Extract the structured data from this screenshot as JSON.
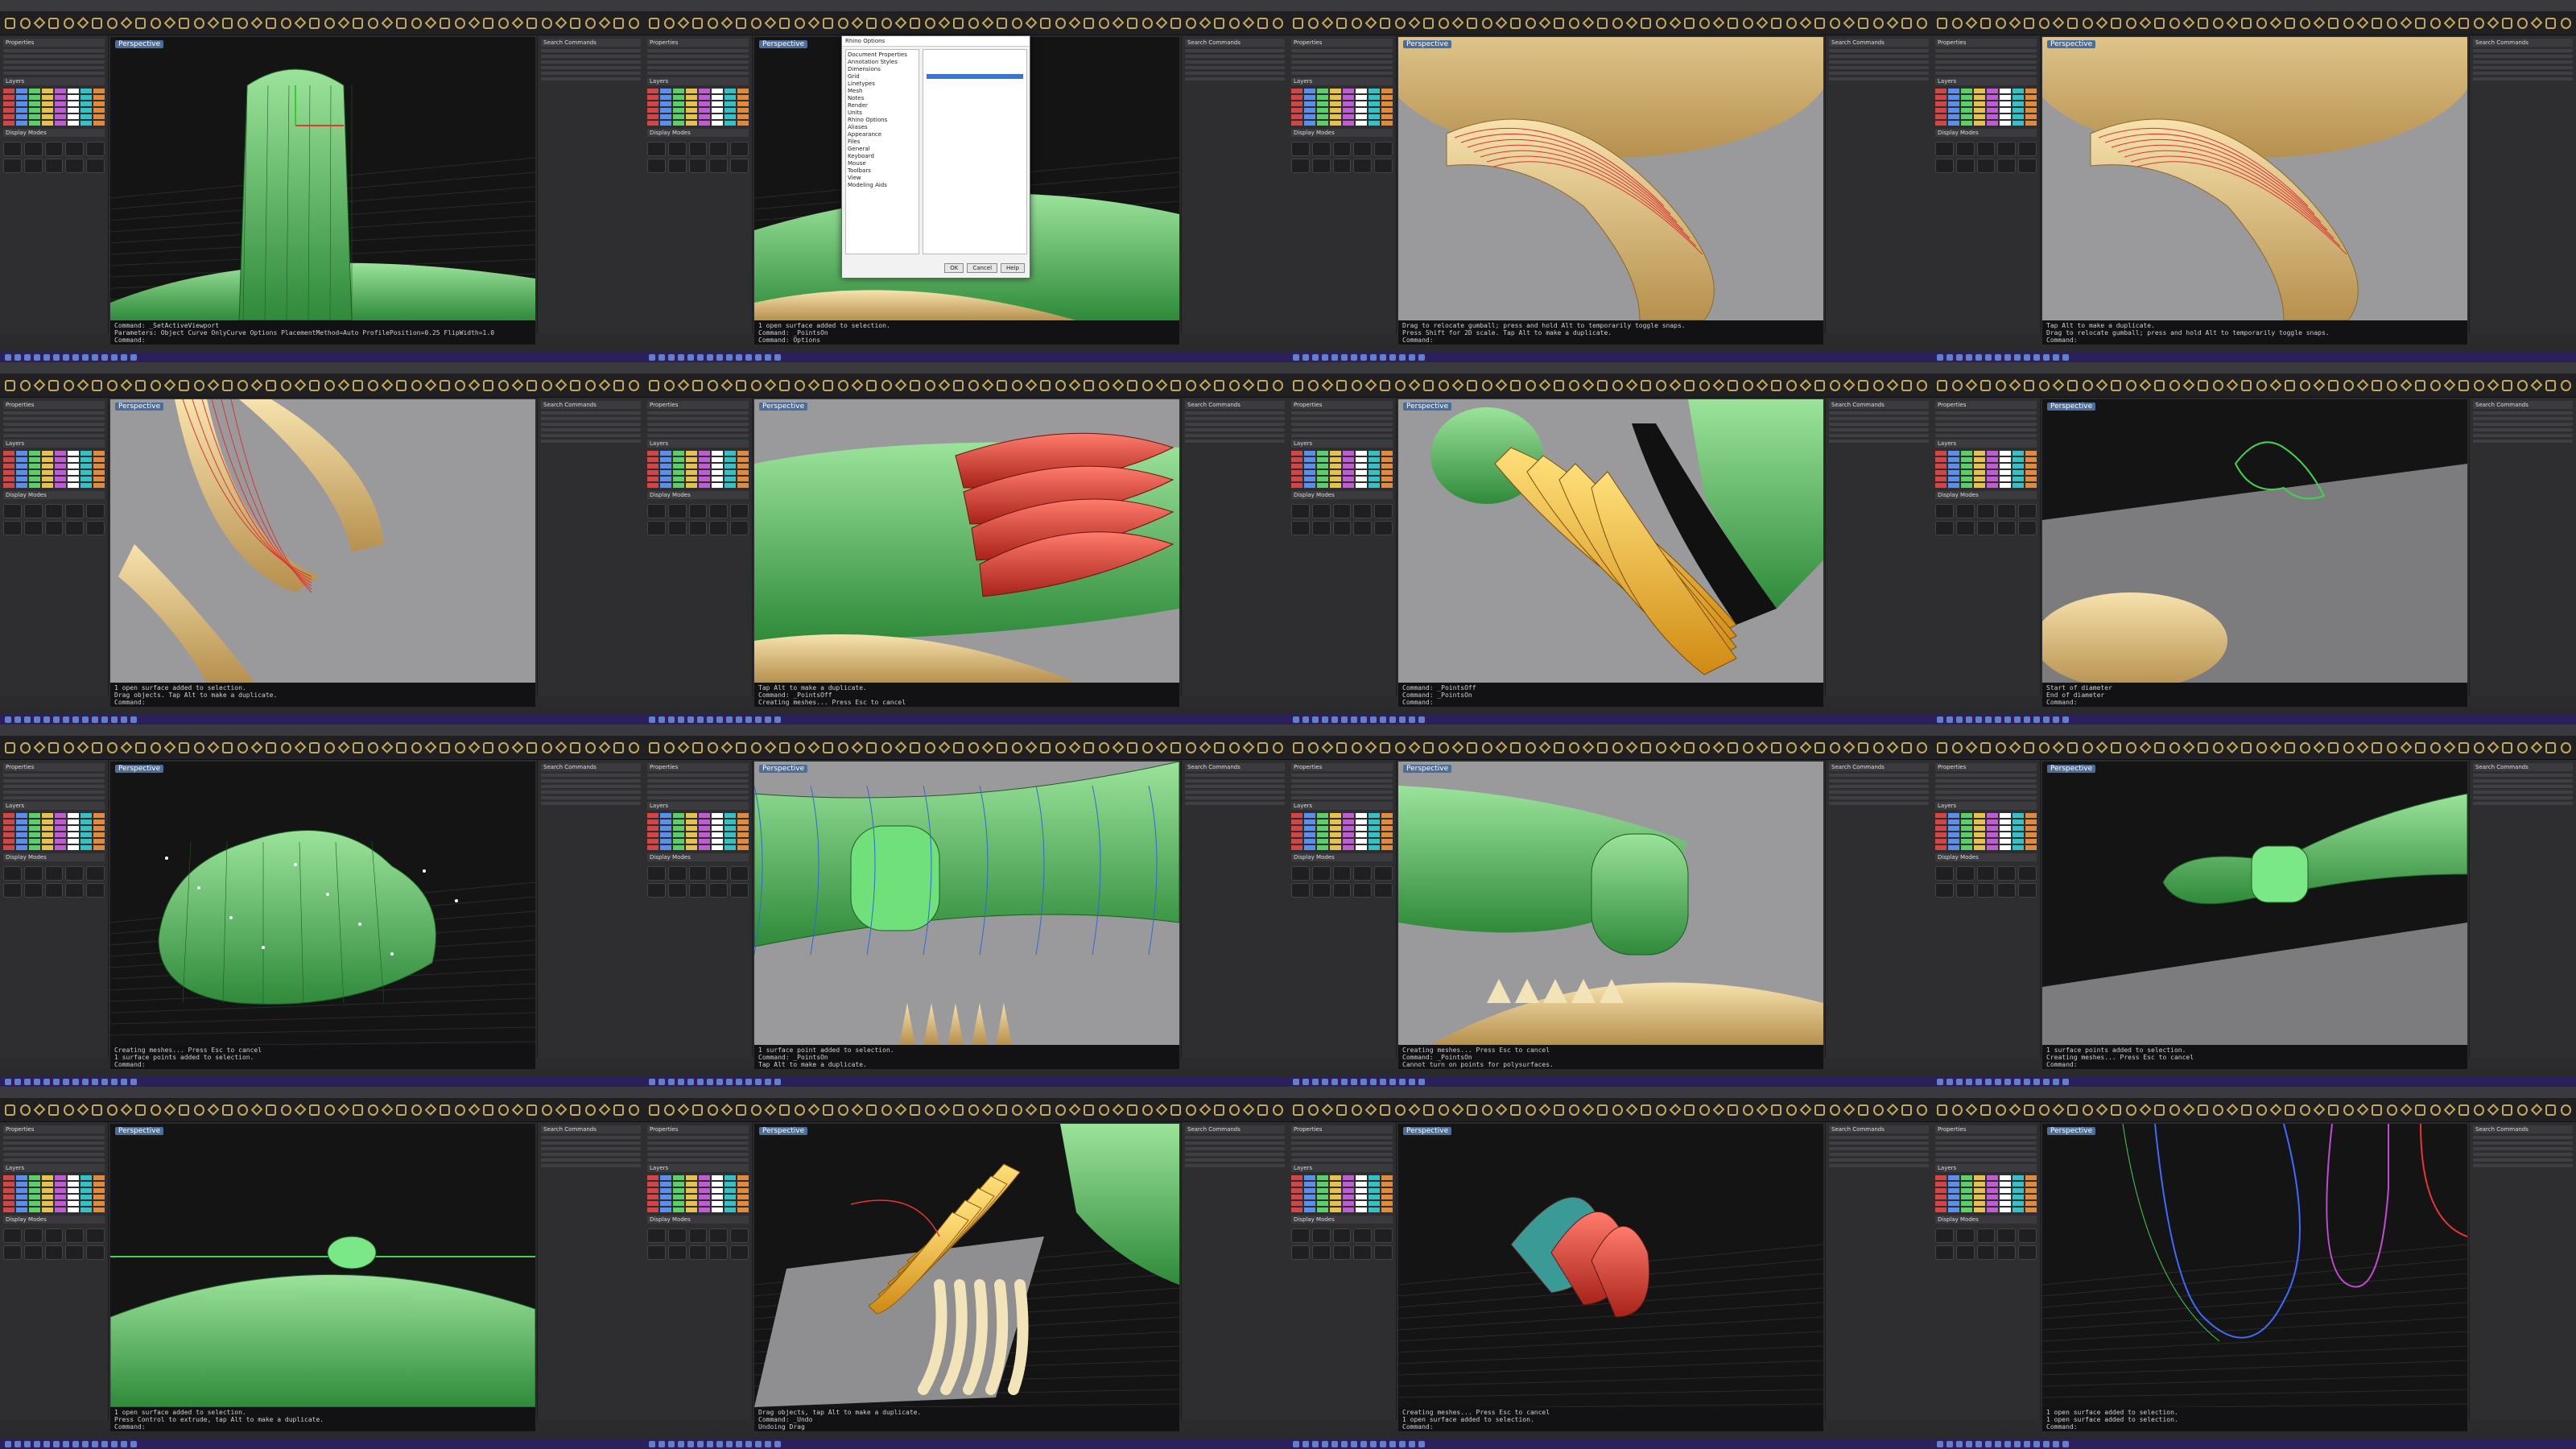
{
  "app": {
    "panel_labels": {
      "properties": "Properties",
      "layers": "Layers",
      "display": "Display Modes",
      "right": "Search Commands"
    },
    "layer_colors": [
      "#d64545",
      "#5a8ff0",
      "#5ad06a",
      "#e6c24a",
      "#c35ad6",
      "#ffffff",
      "#35c2c7",
      "#e08a3a"
    ]
  },
  "dialog": {
    "title": "Rhino Options",
    "left_items": [
      "Document Properties",
      "Annotation Styles",
      "Dimensions",
      "Grid",
      "Linetypes",
      "Mesh",
      "Notes",
      "Render",
      "Units",
      "Rhino Options",
      "Aliases",
      "Appearance",
      "Files",
      "General",
      "Keyboard",
      "Mouse",
      "Toolbars",
      "View",
      "Modeling Aids"
    ],
    "ok": "OK",
    "cancel": "Cancel",
    "help": "Help"
  },
  "cells": [
    {
      "view": "Perspective",
      "cmd": [
        "Command: _SetActiveViewport",
        "Parameters: Object Curve  OnlyCurve  Options  PlacementMethod=Auto  ProfilePosition=0.25  FlipWidth=1.0",
        "Command:"
      ],
      "scene": "green-arch"
    },
    {
      "view": "Perspective",
      "cmd": [
        "1 open surface added to selection.",
        "Command: _PointsOn",
        "Command: Options",
        "Command:"
      ],
      "scene": "options-dialog"
    },
    {
      "view": "Perspective",
      "cmd": [
        "Drag to relocate gumball; press and hold Alt to temporarily toggle snaps.",
        "Press Shift for 2D scale. Tap Alt to make a duplicate.",
        "Command:"
      ],
      "scene": "red-wire-tail"
    },
    {
      "view": "Perspective",
      "cmd": [
        "Tap Alt to make a duplicate.",
        "Drag to relocate gumball; press and hold Alt to temporarily toggle snaps.",
        "Command:"
      ],
      "scene": "red-wire-tail-2"
    },
    {
      "view": "Perspective",
      "cmd": [
        "1 open surface added to selection.",
        "Drag objects. Tap Alt to make a duplicate.",
        "Command:"
      ],
      "scene": "wire-feet"
    },
    {
      "view": "Perspective",
      "cmd": [
        "Tap Alt to make a duplicate.",
        "Command: _PointsOff",
        "Creating meshes... Press Esc to cancel",
        "Command:"
      ],
      "scene": "red-feathers"
    },
    {
      "view": "Perspective",
      "cmd": [
        "Command: _PointsOff",
        "Command: _PointsOn",
        "Command:"
      ],
      "scene": "gold-feathers"
    },
    {
      "view": "Perspective",
      "cmd": [
        "Start of diameter",
        "End of diameter",
        "Command:"
      ],
      "scene": "green-curve"
    },
    {
      "view": "Perspective",
      "cmd": [
        "Creating meshes... Press Esc to cancel",
        "1 surface points added to selection.",
        "Command:"
      ],
      "scene": "green-blob"
    },
    {
      "view": "Perspective",
      "cmd": [
        "1 surface point added to selection.",
        "Command: _PointsOn",
        "Tap Alt to make a duplicate.",
        "Command:"
      ],
      "scene": "green-neck-wire"
    },
    {
      "view": "Perspective",
      "cmd": [
        "Creating meshes... Press Esc to cancel",
        "Command: _PointsOn",
        "Cannot turn on points for polysurfaces.",
        "Command:"
      ],
      "scene": "green-cylinder"
    },
    {
      "view": "Perspective",
      "cmd": [
        "1 surface points added to selection.",
        "Creating meshes... Press Esc to cancel",
        "Command:"
      ],
      "scene": "green-bottle"
    },
    {
      "view": "Perspective",
      "cmd": [
        "1 open surface added to selection.",
        "Press Control to extrude, tap Alt to make a duplicate.",
        "Command:"
      ],
      "scene": "green-dome"
    },
    {
      "view": "Perspective",
      "cmd": [
        "Drag objects, tap Alt to make a duplicate.",
        "Command: _Undo",
        "Undoing Drag",
        "Command:"
      ],
      "scene": "gold-wings"
    },
    {
      "view": "Perspective",
      "cmd": [
        "Creating meshes... Press Esc to cancel",
        "1 open surface added to selection.",
        "Command:"
      ],
      "scene": "red-petals"
    },
    {
      "view": "Perspective",
      "cmd": [
        "1 open surface added to selection.",
        "1 open surface added to selection.",
        "Command:"
      ],
      "scene": "blue-curves"
    }
  ]
}
